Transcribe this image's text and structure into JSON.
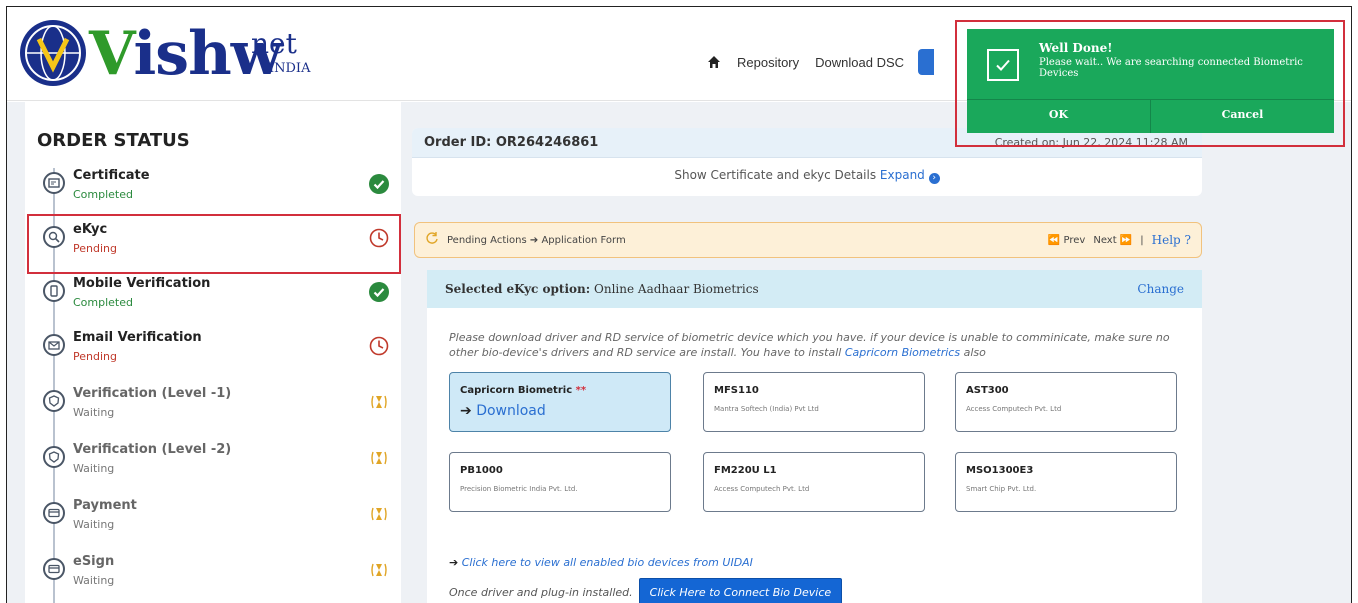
{
  "brand": {
    "name": "ishw",
    "net": "net",
    "india": "INDIA"
  },
  "topnav": {
    "repository": "Repository",
    "download_dsc": "Download DSC"
  },
  "sidebar": {
    "title": "ORDER STATUS",
    "steps": [
      {
        "title": "Certificate",
        "status": "Completed",
        "icon": "certificate-icon",
        "state": "completed"
      },
      {
        "title": "eKyc",
        "status": "Pending",
        "icon": "ekyc-icon",
        "state": "pending"
      },
      {
        "title": "Mobile Verification",
        "status": "Completed",
        "icon": "mobile-icon",
        "state": "completed"
      },
      {
        "title": "Email Verification",
        "status": "Pending",
        "icon": "email-icon",
        "state": "pending"
      },
      {
        "title": "Verification (Level -1)",
        "status": "Waiting",
        "icon": "shield-icon",
        "state": "waiting"
      },
      {
        "title": "Verification (Level -2)",
        "status": "Waiting",
        "icon": "shield-icon",
        "state": "waiting"
      },
      {
        "title": "Payment",
        "status": "Waiting",
        "icon": "card-icon",
        "state": "waiting"
      },
      {
        "title": "eSign",
        "status": "Waiting",
        "icon": "card-icon",
        "state": "waiting"
      }
    ]
  },
  "order": {
    "id_label": "Order ID: OR264246861",
    "created_on": "Created on: Jun 22, 2024 11:28 AM",
    "show_details": "Show Certificate and ekyc Details",
    "expand": "Expand"
  },
  "pending_actions": {
    "label": "Pending Actions",
    "target": "Application Form",
    "prev": "Prev",
    "next": "Next",
    "help": "Help ?"
  },
  "ekyc_option": {
    "label": "Selected eKyc option:",
    "value": "Online Aadhaar Biometrics",
    "change": "Change"
  },
  "devices": {
    "instructions": "Please download driver and RD service of biometric device which you have. if your device is unable to comminicate, make sure no other bio-device's drivers and RD service are install. You have to install",
    "instructions_link": "Capricorn Biometrics",
    "instructions_tail": "also",
    "items": [
      {
        "name": "Capricorn Biometric",
        "required": "**",
        "action": "Download"
      },
      {
        "name": "MFS110",
        "vendor": "Mantra Softech (India) Pvt Ltd"
      },
      {
        "name": "AST300",
        "vendor": "Access Computech Pvt. Ltd"
      },
      {
        "name": "PB1000",
        "vendor": "Precision Biometric India Pvt. Ltd."
      },
      {
        "name": "FM220U L1",
        "vendor": "Access Computech Pvt. Ltd"
      },
      {
        "name": "MSO1300E3",
        "vendor": "Smart Chip Pvt. Ltd."
      }
    ],
    "uidai_link": "Click here to view all enabled bio devices from UIDAI",
    "connect_prefix": "Once driver and plug-in installed.",
    "connect_button": "Click Here to Connect Bio Device"
  },
  "toast": {
    "title": "Well Done!",
    "message": "Please wait.. We are searching connected Biometric Devices",
    "ok": "OK",
    "cancel": "Cancel"
  },
  "colors": {
    "accent": "#2a6fd1",
    "success": "#1aa85b",
    "pending": "#c0392b",
    "highlight": "#d22f3c"
  }
}
